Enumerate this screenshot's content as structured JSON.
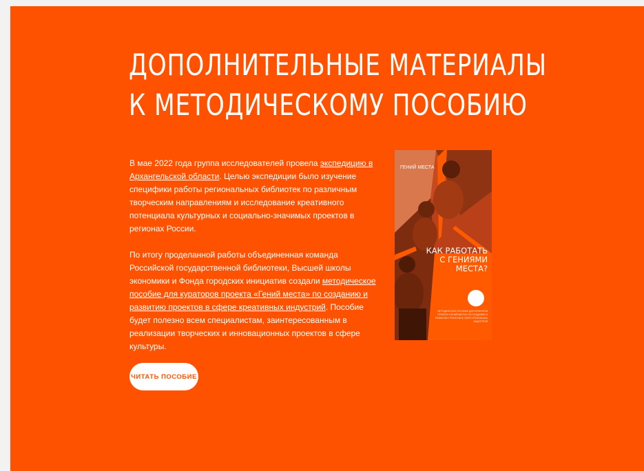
{
  "colors": {
    "page_bg": "#f2f2f2",
    "accent": "#ff5200",
    "text": "#ffffff"
  },
  "heading": {
    "line1": "ДОПОЛНИТЕЛЬНЫЕ МАТЕРИАЛЫ",
    "line2": "К МЕТОДИЧЕСКОМУ ПОСОБИЮ"
  },
  "paragraph1": {
    "before": "В мае 2022 года группа исследователей провела ",
    "link": "экспедицию в Архангельской области",
    "after": ". Целью экспедиции было изучение специфики работы региональных библиотек по различным творческим направлениям и исследование креативного потенциала культурных и социально-значимых проектов в регионах России."
  },
  "paragraph2": {
    "before": "По итогу проделанной работы объединенная команда Российской государственной библиотеки, Высшей школы экономики и Фонда городских инициатив создали ",
    "link": "методическое пособие для кураторов проекта «Гений места» по созданию и развитию проектов в сфере креативных индустрий",
    "after": ". Пособие будет полезно всем специалистам, заинтересованным в реализации творческих и инновационных проектов в сфере культуры."
  },
  "cover": {
    "logo_text": "ГЕНИЙ МЕСТА",
    "title": "КАК РАБОТАТЬ\nС ГЕНИЯМИ\nМЕСТА?",
    "subtitle": "МЕТОДИЧЕСКОЕ ПОСОБИЕ ДЛЯ КУРАТОРОВ ПРОЕКТА «ГЕНИЙ МЕСТА» ПО СОЗДАНИЮ И РАЗВИТИЮ ПРОЕКТОВ В СФЕРЕ КРЕАТИВНЫХ ИНДУСТРИЙ"
  },
  "button": {
    "label": "ЧИТАТЬ ПОСОБИЕ"
  }
}
